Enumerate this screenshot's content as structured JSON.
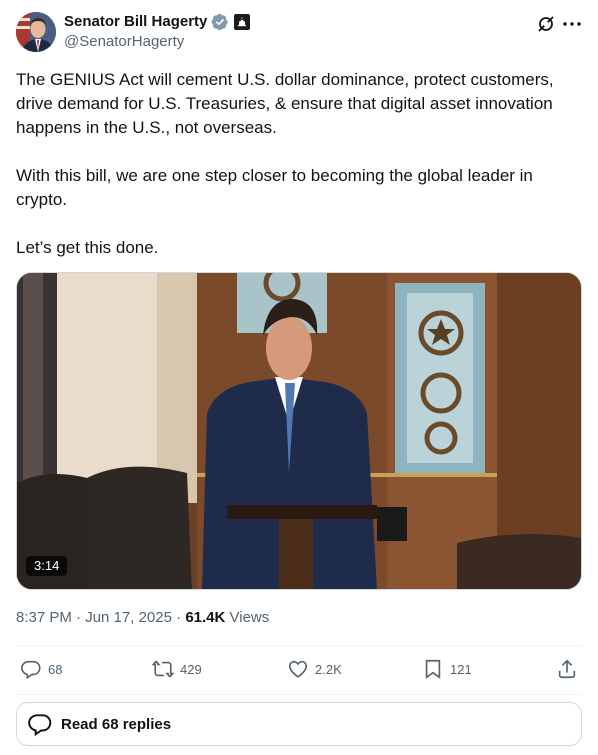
{
  "author": {
    "display_name": "Senator Bill Hagerty",
    "handle": "@SenatorHagerty"
  },
  "tweet": {
    "paragraphs": [
      "The GENIUS Act will cement U.S. dollar dominance, protect customers, drive demand for U.S. Treasuries, & ensure that digital asset innovation happens in the U.S., not overseas.",
      "With this bill, we are one step closer to becoming the global leader in crypto.",
      "Let’s get this done."
    ]
  },
  "video": {
    "duration": "3:14"
  },
  "meta": {
    "time": "8:37 PM",
    "separator": " · ",
    "date": "Jun 17, 2025",
    "separator2": " · ",
    "views_count": "61.4K",
    "views_label": " Views"
  },
  "actions": {
    "replies": "68",
    "reposts": "429",
    "likes": "2.2K",
    "bookmarks": "121"
  },
  "replies_button": {
    "label": "Read 68 replies"
  },
  "colors": {
    "text": "#0f1419",
    "secondary": "#536471",
    "verified": "#829aab",
    "border": "#cfd9de"
  }
}
